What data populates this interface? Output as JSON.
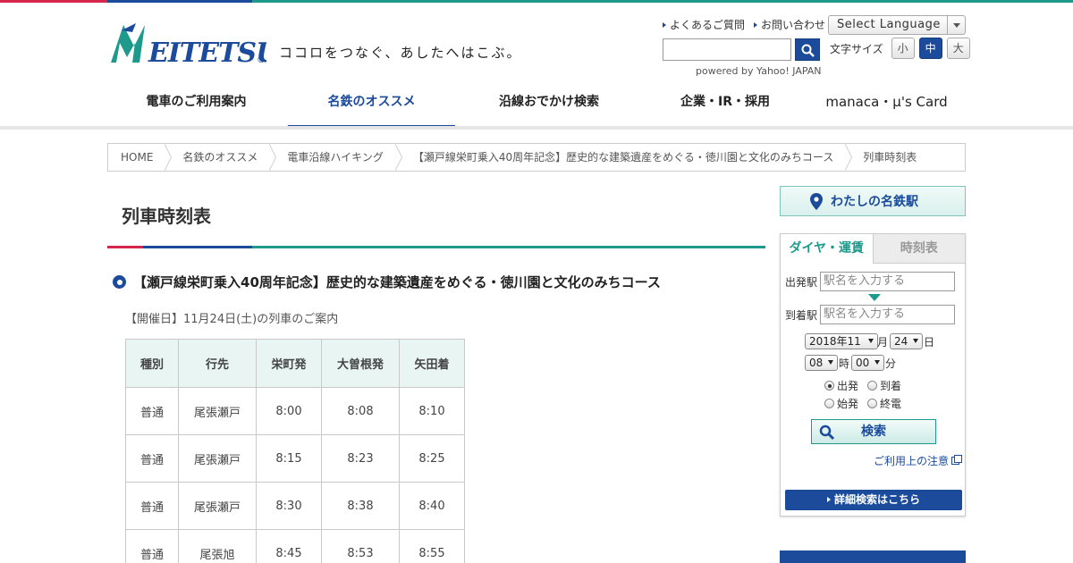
{
  "header": {
    "logo_text": "MEITETSU",
    "tagline": "ココロをつなぐ、あしたへはこぶ。",
    "links": [
      "よくあるご質問",
      "お問い合わせ"
    ],
    "language_select": "Select Language",
    "search_placeholder": "",
    "powered_by": "powered by Yahoo! JAPAN",
    "font_size_label": "文字サイズ",
    "font_sizes": [
      "小",
      "中",
      "大"
    ],
    "active_font_size": "中"
  },
  "nav": {
    "items": [
      "電車のご利用案内",
      "名鉄のオススメ",
      "沿線おでかけ検索",
      "企業・IR・採用",
      "manaca・μ's Card"
    ],
    "active": "名鉄のオススメ"
  },
  "breadcrumb": [
    "HOME",
    "名鉄のオススメ",
    "電車沿線ハイキング",
    "【瀬戸線栄町乗入40周年記念】歴史的な建築遺産をめぐる・徳川園と文化のみちコース",
    "列車時刻表"
  ],
  "main": {
    "title": "列車時刻表",
    "section_title": "【瀬戸線栄町乗入40周年記念】歴史的な建築遺産をめぐる・徳川園と文化のみちコース",
    "event_date": "【開催日】11月24日(土)の列車のご案内",
    "table": {
      "headers": [
        "種別",
        "行先",
        "栄町発",
        "大曽根発",
        "矢田着"
      ],
      "rows": [
        [
          "普通",
          "尾張瀬戸",
          "8:00",
          "8:08",
          "8:10"
        ],
        [
          "普通",
          "尾張瀬戸",
          "8:15",
          "8:23",
          "8:25"
        ],
        [
          "普通",
          "尾張瀬戸",
          "8:30",
          "8:38",
          "8:40"
        ],
        [
          "普通",
          "尾張旭",
          "8:45",
          "8:53",
          "8:55"
        ]
      ]
    }
  },
  "sidebar": {
    "my_station": "わたしの名鉄駅",
    "tabs": [
      "ダイヤ・運賃",
      "時刻表"
    ],
    "active_tab": "ダイヤ・運賃",
    "from_label": "出発駅",
    "to_label": "到着駅",
    "station_placeholder": "駅名を入力する",
    "date": {
      "year_month": "2018年11",
      "month_unit": "月",
      "day": "24",
      "day_unit": "日"
    },
    "time": {
      "hour": "08",
      "hour_unit": "時",
      "minute": "00",
      "minute_unit": "分"
    },
    "radio_options": [
      "出発",
      "到着",
      "始発",
      "終電"
    ],
    "radio_selected": "出発",
    "search_button": "検索",
    "usage_note": "ご利用上の注意",
    "detail_search": "詳細検索はこちら"
  },
  "colors": {
    "brand_blue": "#1b4b9a",
    "brand_teal": "#1e9a8d",
    "brand_red": "#d6264b"
  }
}
